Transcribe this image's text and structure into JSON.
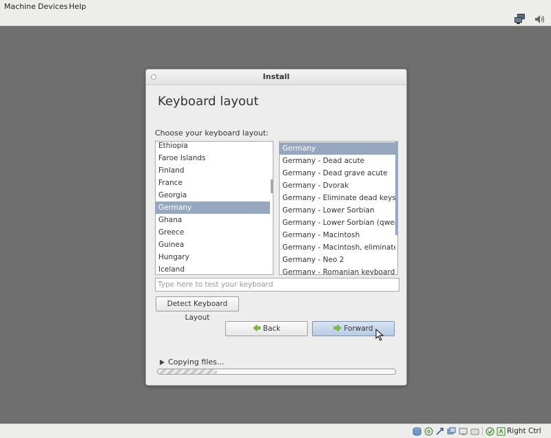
{
  "menubar": {
    "items": [
      "Machine",
      "Devices",
      "Help"
    ]
  },
  "window": {
    "title": "Install",
    "page_title": "Keyboard layout",
    "choose_label": "Choose your keyboard layout:",
    "countries": [
      "Ethiopia",
      "Faroe Islands",
      "Finland",
      "France",
      "Georgia",
      "Germany",
      "Ghana",
      "Greece",
      "Guinea",
      "Hungary",
      "Iceland"
    ],
    "selected_country": "Germany",
    "variants": [
      "Germany",
      "Germany - Dead acute",
      "Germany - Dead grave acute",
      "Germany - Dvorak",
      "Germany - Eliminate dead keys",
      "Germany - Lower Sorbian",
      "Germany - Lower Sorbian (qwertz)",
      "Germany - Macintosh",
      "Germany - Macintosh, eliminate dead keys",
      "Germany - Neo 2",
      "Germany - Romanian keyboard with German letters"
    ],
    "selected_variant": "Germany",
    "test_placeholder": "Type here to test your keyboard",
    "detect_button": "Detect Keyboard Layout",
    "back_button": "Back",
    "forward_button": "Forward",
    "progress_label": "Copying files...",
    "progress_fraction": 0.25
  },
  "statusbar": {
    "host_key": "Right Ctrl"
  },
  "icons": {
    "network": "network-icon",
    "volume": "volume-icon",
    "harddisk": "harddisk-status-icon",
    "optical": "optical-status-icon",
    "usb": "usb-status-icon",
    "shared": "shared-folders-status-icon",
    "display": "display-status-icon",
    "capture": "capture-status-icon",
    "hostkey": "host-key-icon"
  },
  "colors": {
    "selection": "#95a8bf",
    "vm_background": "#6f6f6f",
    "forward_button": "#c7d7ea"
  }
}
